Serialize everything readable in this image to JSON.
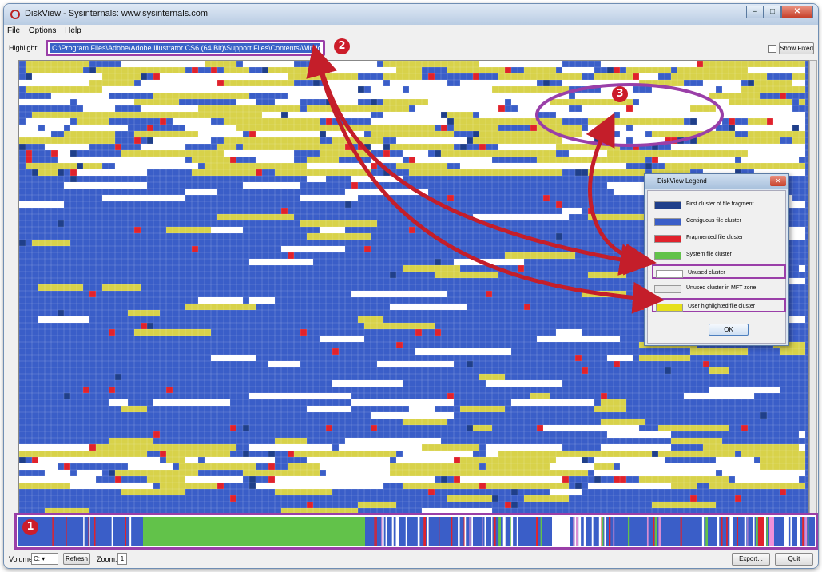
{
  "window": {
    "title": "DiskView - Sysinternals: www.sysinternals.com",
    "minimize_glyph": "–",
    "maximize_glyph": "□",
    "close_glyph": "✕"
  },
  "menu": [
    "File",
    "Options",
    "Help"
  ],
  "highlight": {
    "label": "Highlight:",
    "path": "C:\\Program Files\\Adobe\\Adobe Illustrator CS6 (64 Bit)\\Support Files\\Contents\\Windows\\Illustrator.exe"
  },
  "show_fixed": {
    "label": "Show Fixed",
    "checked": false
  },
  "bottom": {
    "volume_label": "Volume:",
    "volume_value": "C:",
    "refresh_label": "Refresh",
    "zoom_label": "Zoom:",
    "zoom_value": "1",
    "export_label": "Export...",
    "quit_label": "Quit"
  },
  "legend": {
    "title": "DiskView Legend",
    "close_glyph": "✕",
    "ok_label": "OK",
    "items": [
      {
        "label": "First cluster of file fragment",
        "color": "#1f3f8a"
      },
      {
        "label": "Contiguous file cluster",
        "color": "#3a5ec8"
      },
      {
        "label": "Fragmented file cluster",
        "color": "#e0222c"
      },
      {
        "label": "System file cluster",
        "color": "#62c24a"
      },
      {
        "label": "Unused cluster",
        "color": "#ffffff"
      },
      {
        "label": "Unused cluster in MFT zone",
        "color": "#e8e8e8"
      },
      {
        "label": "User highlighted file cluster",
        "color": "#e6e01a"
      }
    ]
  },
  "callouts": [
    "1",
    "2",
    "3"
  ],
  "colors": {
    "contiguous": "#3a5ec8",
    "first_fragment": "#1f3f8a",
    "fragmented": "#e0222c",
    "system": "#62c24a",
    "unused": "#ffffff",
    "highlighted": "#d8d24a",
    "annotation_arrow": "#c41e2a",
    "annotation_frame": "#9a3fa8"
  }
}
